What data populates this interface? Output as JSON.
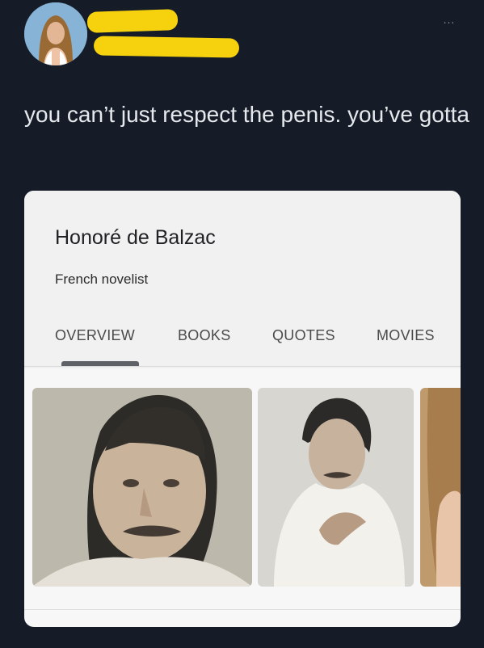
{
  "tweet": {
    "text": "you can’t just respect the penis. you’ve gotta"
  },
  "header": {
    "more_icon": "more-horizontal-icon",
    "more_label": "..."
  },
  "card": {
    "title": "Honoré de Balzac",
    "subtitle": "French novelist",
    "tabs": [
      {
        "label": "OVERVIEW",
        "active": true
      },
      {
        "label": "BOOKS",
        "active": false
      },
      {
        "label": "QUOTES",
        "active": false
      },
      {
        "label": "MOVIES",
        "active": false
      }
    ]
  },
  "colors": {
    "background": "#151c28",
    "redaction": "#f5d10e",
    "card": "#f7f7f7"
  }
}
